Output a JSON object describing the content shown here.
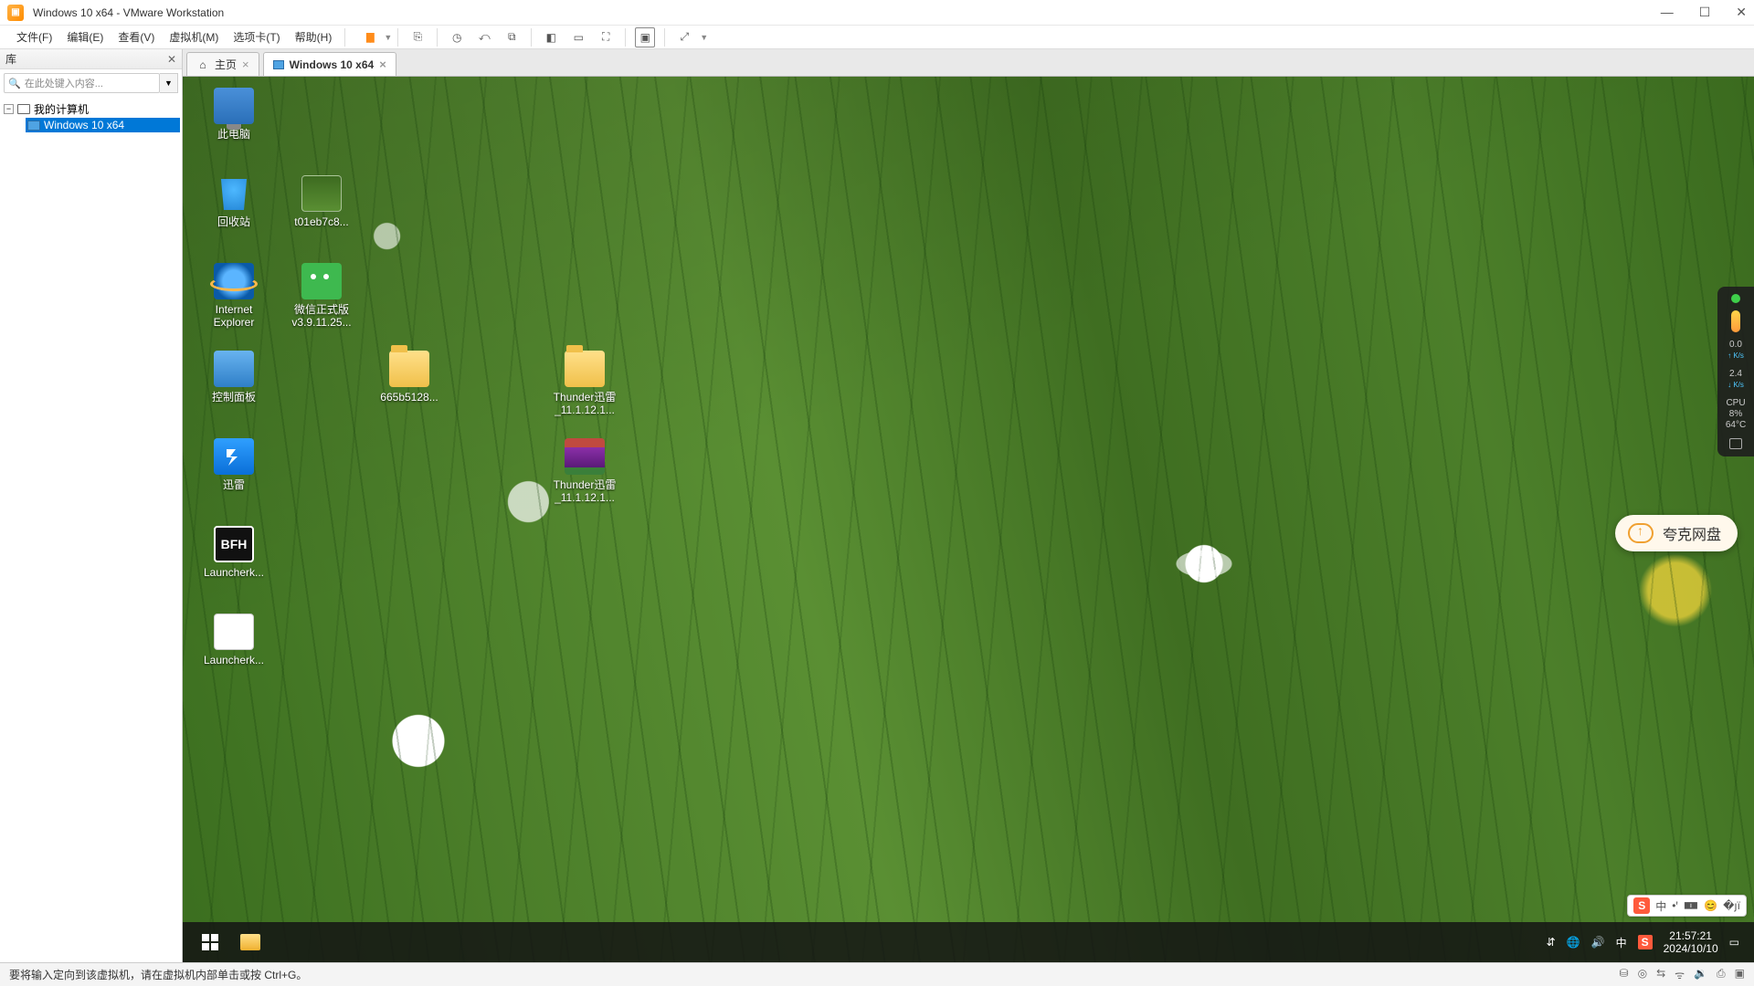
{
  "host": {
    "title": "Windows 10 x64 - VMware Workstation",
    "menus": {
      "file": "文件(F)",
      "edit": "编辑(E)",
      "view": "查看(V)",
      "vm": "虚拟机(M)",
      "tabs": "选项卡(T)",
      "help": "帮助(H)"
    },
    "library_title": "库",
    "search_placeholder": "在此处键入内容...",
    "tree_root": "我的计算机",
    "tree_child": "Windows 10 x64",
    "tab_home": "主页",
    "tab_vm": "Windows 10 x64",
    "status_text": "要将输入定向到该虚拟机，请在虚拟机内部单击或按 Ctrl+G。"
  },
  "guest": {
    "icons": {
      "thispc": "此电脑",
      "recycle": "回收站",
      "imgfile": "t01eb7c8...",
      "ie1": "Internet",
      "ie2": "Explorer",
      "wechat1": "微信正式版",
      "wechat2": "v3.9.11.25...",
      "cpanel": "控制面板",
      "folder665": "665b5128...",
      "thunder1": "Thunder迅雷",
      "thunder2": "_11.1.12.1...",
      "xunlei": "迅雷",
      "thunderrar1": "Thunder迅雷",
      "thunderrar2": "_11.1.12.1...",
      "bfh": "Launcherk...",
      "bfh_text": "BFH",
      "launcherk": "Launcherk..."
    },
    "quark_label": "夸克网盘",
    "taskbar_time": "21:57:21",
    "taskbar_date": "2024/10/10",
    "tray_ime": "中",
    "ime_sogou": "S",
    "ime_items": {
      "lang": "中",
      "punct": "•ꞌ",
      "full": "🀰",
      "emoji": "😊",
      "menu": "�յї"
    },
    "perf": {
      "up": "0.0",
      "up_u": "↑ K/s",
      "dn": "2.4",
      "dn_u": "↓ K/s",
      "cpu_l": "CPU",
      "cpu_v": "8%",
      "temp": "64°C"
    }
  }
}
